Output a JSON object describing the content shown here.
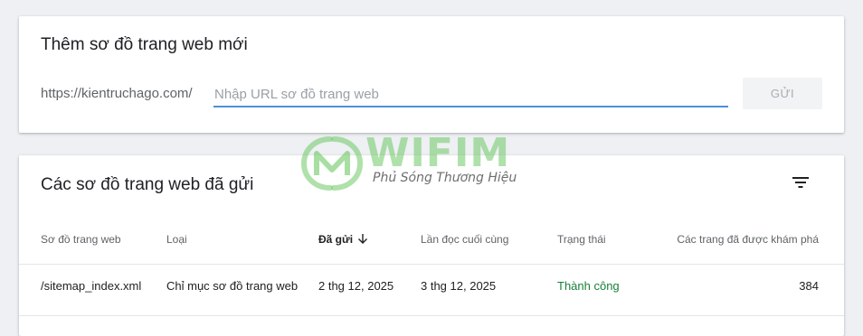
{
  "add_sitemap": {
    "title": "Thêm sơ đồ trang web mới",
    "url_prefix": "https://kientruchago.com/",
    "input_placeholder": "Nhập URL sơ đồ trang web",
    "input_value": "",
    "submit_label": "GỬI"
  },
  "submitted": {
    "title": "Các sơ đồ trang web đã gửi",
    "filter_icon": "filter-icon",
    "sort_icon": "arrow-down-icon",
    "columns": [
      "Sơ đồ trang web",
      "Loại",
      "Đã gửi",
      "Lần đọc cuối cùng",
      "Trạng thái",
      "Các trang đã được khám phá"
    ],
    "rows": [
      [
        "/sitemap_index.xml",
        "Chỉ mục sơ đồ trang web",
        "2 thg 12, 2025",
        "3 thg 12, 2025",
        "Thành công",
        "384"
      ]
    ]
  },
  "watermark": {
    "brand": "WIFIM",
    "slogan": "Phủ Sóng Thương Hiệu"
  },
  "colors": {
    "background": "#eef0f3",
    "input_focus_line": "#4a90d9",
    "status_success": "#188038",
    "watermark_green": "#6ec864"
  }
}
